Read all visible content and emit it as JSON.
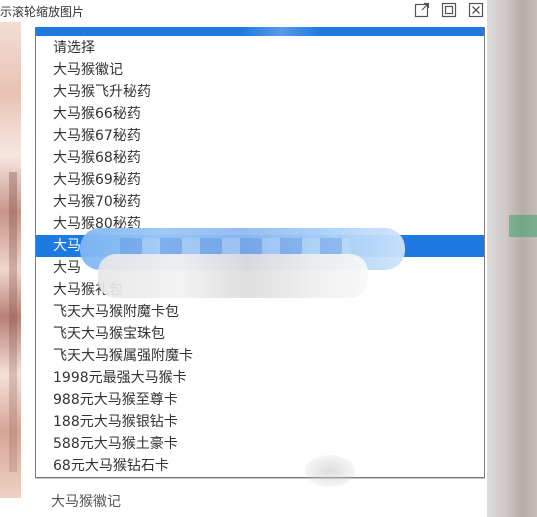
{
  "window": {
    "title": "示滚轮缩放图片",
    "buttons": {
      "popout": "popout-icon",
      "restore": "restore-icon",
      "close": "close-icon"
    }
  },
  "dropdown": {
    "options": [
      "请选择",
      "大马猴徽记",
      "大马猴飞升秘药",
      "大马猴66秘药",
      "大马猴67秘药",
      "大马猴68秘药",
      "大马猴69秘药",
      "大马猴70秘药",
      "大马猴80秘药",
      "大马",
      "大马",
      "大马猴礼包",
      "飞天大马猴附魔卡包",
      "飞天大马猴宝珠包",
      "飞天大马猴属强附魔卡",
      "1998元最强大马猴卡",
      "988元大马猴至尊卡",
      "188元大马猴银钻卡",
      "588元大马猴土豪卡",
      "68元大马猴钻石卡"
    ],
    "selected_index": 9
  },
  "underfield": {
    "value": "大马猴徽记"
  },
  "colors": {
    "accent": "#1e7ae0"
  }
}
